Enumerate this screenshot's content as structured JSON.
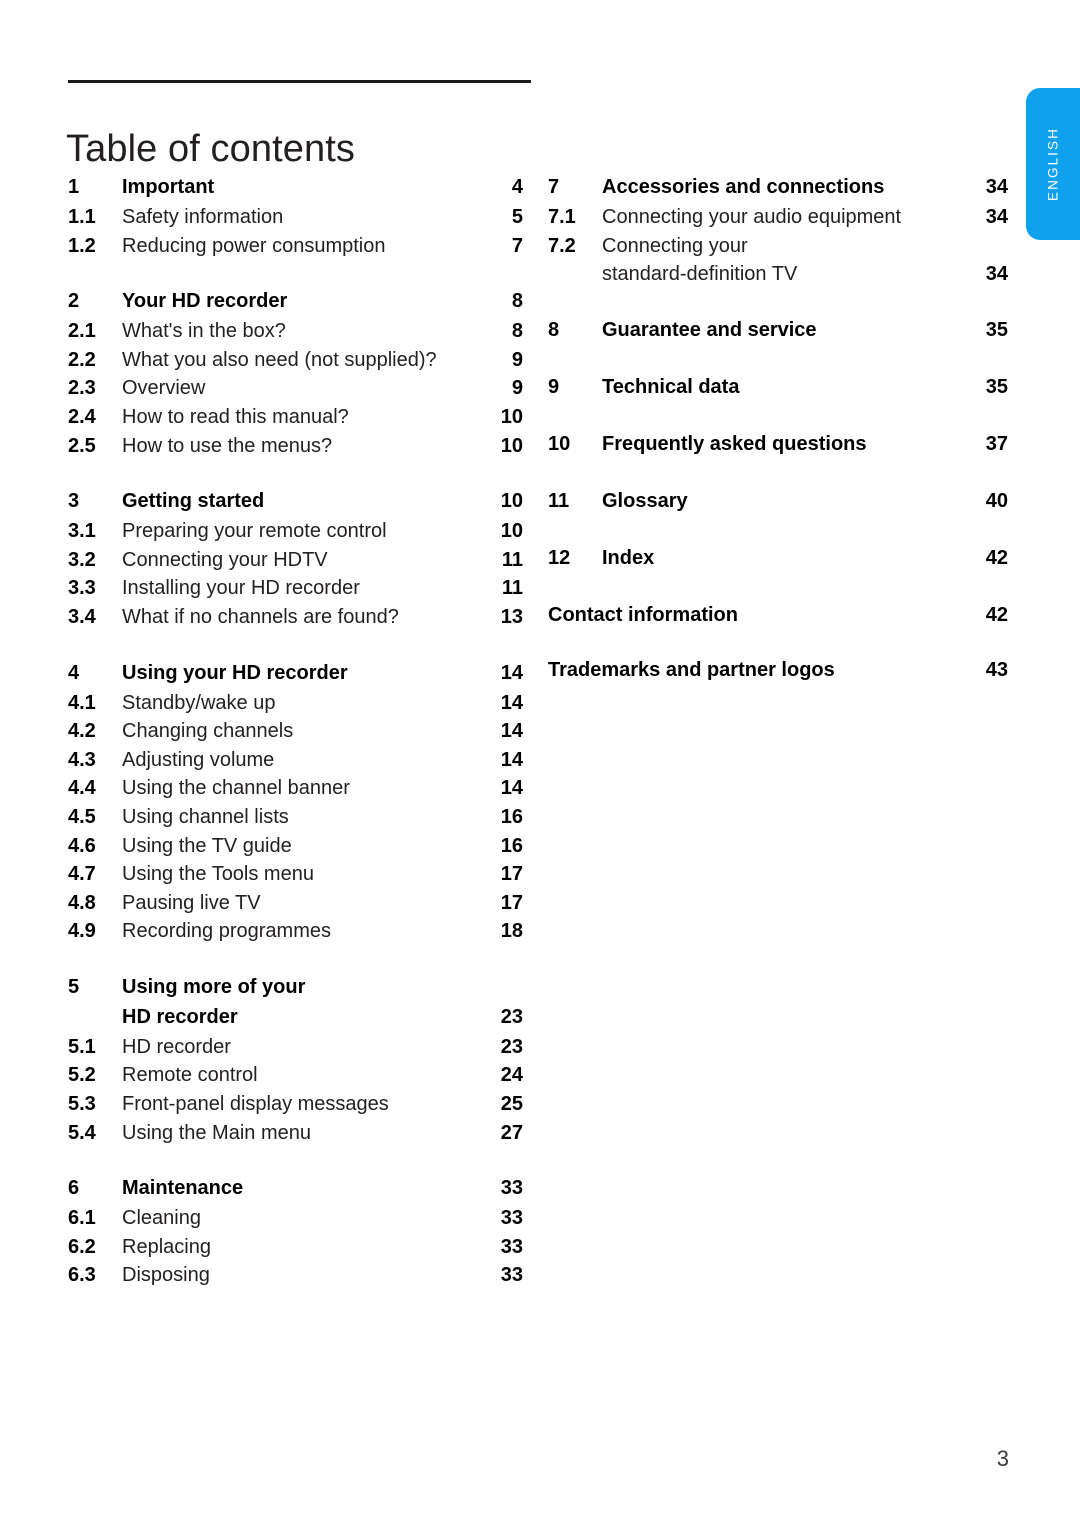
{
  "page": {
    "title": "Table of contents",
    "folio": "3"
  },
  "language_tab": {
    "label": "ENGLISH",
    "color": "#0fa1ee"
  },
  "toc": {
    "left_column": [
      {
        "heading": {
          "num": "1",
          "title": "Important",
          "page": "4"
        },
        "entries": [
          {
            "num": "1.1",
            "title": "Safety information",
            "page": "5"
          },
          {
            "num": "1.2",
            "title": "Reducing power consumption",
            "page": "7"
          }
        ]
      },
      {
        "heading": {
          "num": "2",
          "title": "Your HD recorder",
          "page": "8"
        },
        "entries": [
          {
            "num": "2.1",
            "title": "What's in the box?",
            "page": "8"
          },
          {
            "num": "2.2",
            "title": "What you also need (not supplied)?",
            "page": "9"
          },
          {
            "num": "2.3",
            "title": "Overview",
            "page": "9"
          },
          {
            "num": "2.4",
            "title": "How to read this manual?",
            "page": "10"
          },
          {
            "num": "2.5",
            "title": "How to use the menus?",
            "page": "10"
          }
        ]
      },
      {
        "heading": {
          "num": "3",
          "title": "Getting started",
          "page": "10"
        },
        "entries": [
          {
            "num": "3.1",
            "title": "Preparing your remote control",
            "page": "10"
          },
          {
            "num": "3.2",
            "title": "Connecting your HDTV",
            "page": "11"
          },
          {
            "num": "3.3",
            "title": "Installing your HD recorder",
            "page": "11"
          },
          {
            "num": "3.4",
            "title": "What if no channels are found?",
            "page": "13"
          }
        ]
      },
      {
        "heading": {
          "num": "4",
          "title": "Using your HD recorder",
          "page": "14"
        },
        "entries": [
          {
            "num": "4.1",
            "title": "Standby/wake up",
            "page": "14"
          },
          {
            "num": "4.2",
            "title": "Changing channels",
            "page": "14"
          },
          {
            "num": "4.3",
            "title": "Adjusting volume",
            "page": "14"
          },
          {
            "num": "4.4",
            "title": "Using the channel banner",
            "page": "14"
          },
          {
            "num": "4.5",
            "title": "Using channel lists",
            "page": "16"
          },
          {
            "num": "4.6",
            "title": "Using the TV guide",
            "page": "16"
          },
          {
            "num": "4.7",
            "title": "Using the Tools menu",
            "page": "17"
          },
          {
            "num": "4.8",
            "title": "Pausing live TV",
            "page": "17"
          },
          {
            "num": "4.9",
            "title": "Recording programmes",
            "page": "18"
          }
        ]
      },
      {
        "heading": {
          "num": "5",
          "title": "Using more of your",
          "page": ""
        },
        "heading_line2": {
          "title": "HD recorder",
          "page": "23"
        },
        "entries": [
          {
            "num": "5.1",
            "title": "HD recorder",
            "page": "23"
          },
          {
            "num": "5.2",
            "title": "Remote control",
            "page": "24"
          },
          {
            "num": "5.3",
            "title": "Front-panel display messages",
            "page": "25"
          },
          {
            "num": "5.4",
            "title": "Using the Main menu",
            "page": "27"
          }
        ]
      },
      {
        "heading": {
          "num": "6",
          "title": "Maintenance",
          "page": "33"
        },
        "entries": [
          {
            "num": "6.1",
            "title": "Cleaning",
            "page": "33"
          },
          {
            "num": "6.2",
            "title": "Replacing",
            "page": "33"
          },
          {
            "num": "6.3",
            "title": "Disposing",
            "page": "33"
          }
        ]
      }
    ],
    "right_column": [
      {
        "heading": {
          "num": "7",
          "title": "Accessories and connections",
          "page": "34"
        },
        "entries": [
          {
            "num": "7.1",
            "title": "Connecting your audio equipment",
            "page": "34"
          },
          {
            "num": "7.2",
            "title": "Connecting your",
            "page": ""
          }
        ],
        "entry_line2": {
          "title": "standard-definition TV",
          "page": "34"
        }
      },
      {
        "heading": {
          "num": "8",
          "title": "Guarantee and service",
          "page": "35"
        },
        "entries": []
      },
      {
        "heading": {
          "num": "9",
          "title": "Technical data",
          "page": "35"
        },
        "entries": []
      },
      {
        "heading": {
          "num": "10",
          "title": "Frequently asked questions",
          "page": "37"
        },
        "entries": []
      },
      {
        "heading": {
          "num": "11",
          "title": "Glossary",
          "page": "40"
        },
        "entries": []
      },
      {
        "heading": {
          "num": "12",
          "title": "Index",
          "page": "42"
        },
        "entries": []
      },
      {
        "unnumbered": {
          "title": "Contact information",
          "page": "42"
        },
        "entries": []
      },
      {
        "unnumbered": {
          "title": "Trademarks and partner logos",
          "page": "43"
        },
        "entries": []
      }
    ]
  }
}
